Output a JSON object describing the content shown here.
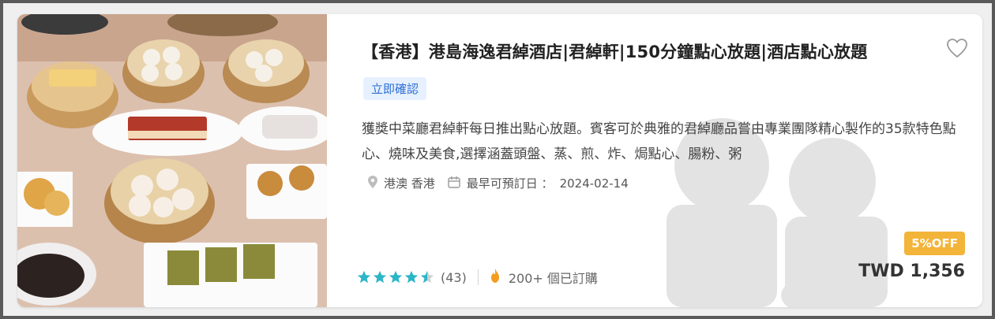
{
  "product": {
    "title": "【香港】港島海逸君綽酒店|君綽軒|150分鐘點心放題|酒店點心放題",
    "badge": "立即確認",
    "description": "獲獎中菜廳君綽軒每日推出點心放題。賓客可於典雅的君綽廳品嘗由專業團隊精心製作的35款特色點心、燒味及美食,選擇涵蓋頭盤、蒸、煎、炸、焗點心、腸粉、粥",
    "location": "港澳 香港",
    "date_label": "最早可預訂日 ：",
    "date_value": "2024-02-14",
    "rating": 4.5,
    "rating_count": "(43)",
    "booked": "200+ 個已訂購",
    "discount": "5%OFF",
    "price": "TWD 1,356",
    "icons": {
      "favorite": "heart-outline-icon",
      "location": "location-pin-icon",
      "calendar": "calendar-icon",
      "popular": "fire-icon",
      "star": "star-icon"
    },
    "colors": {
      "badge_bg": "#e6f0ff",
      "badge_text": "#2d6fd6",
      "star": "#2bb6c7",
      "discount_bg": "#f3b43a",
      "fire": "#f39c1f"
    }
  }
}
